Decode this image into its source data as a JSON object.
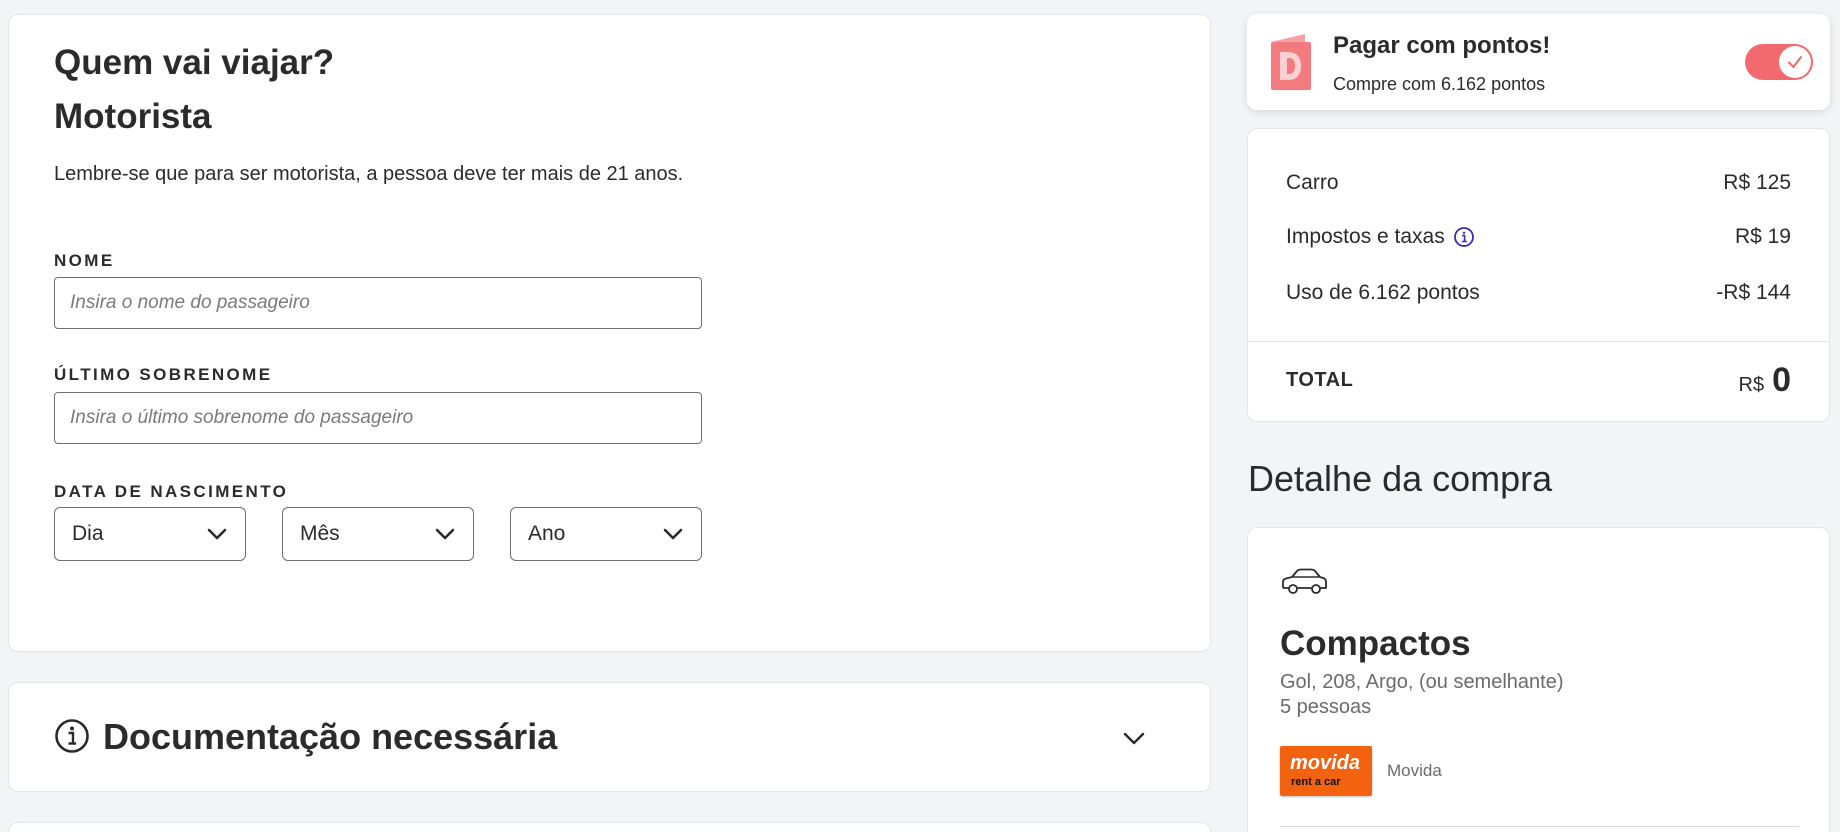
{
  "form": {
    "title": "Quem vai viajar?",
    "subtitle": "Motorista",
    "note": "Lembre-se que para ser motorista, a pessoa deve ter mais de 21 anos.",
    "first_name_label": "NOME",
    "first_name_placeholder": "Insira o nome do passageiro",
    "last_name_label": "ÚLTIMO SOBRENOME",
    "last_name_placeholder": "Insira o último sobrenome do passageiro",
    "birth_label": "DATA DE NASCIMENTO",
    "day": "Dia",
    "month": "Mês",
    "year": "Ano"
  },
  "docs": {
    "title": "Documentação necessária",
    "icon": "info-circle-icon"
  },
  "points": {
    "title": "Pagar com pontos!",
    "subtitle": "Compre com 6.162 pontos",
    "toggle_on": true,
    "accent": "#f26a70"
  },
  "summary": {
    "rows": [
      {
        "label": "Carro",
        "value": "R$ 125"
      },
      {
        "label": "Impostos e taxas",
        "value": "R$ 19"
      },
      {
        "label": "Uso de 6.162 pontos",
        "value": "-R$ 144"
      }
    ],
    "total_label": "TOTAL",
    "total_currency": "R$",
    "total_amount": "0"
  },
  "detail": {
    "title": "Detalhe da compra",
    "car_class": "Compactos",
    "models": "Gol, 208, Argo, (ou semelhante)",
    "seats": "5 pessoas",
    "supplier_logo_main": "movida",
    "supplier_logo_tag": "rent a car",
    "supplier_name": "Movida",
    "supplier_color": "#f2620f"
  }
}
